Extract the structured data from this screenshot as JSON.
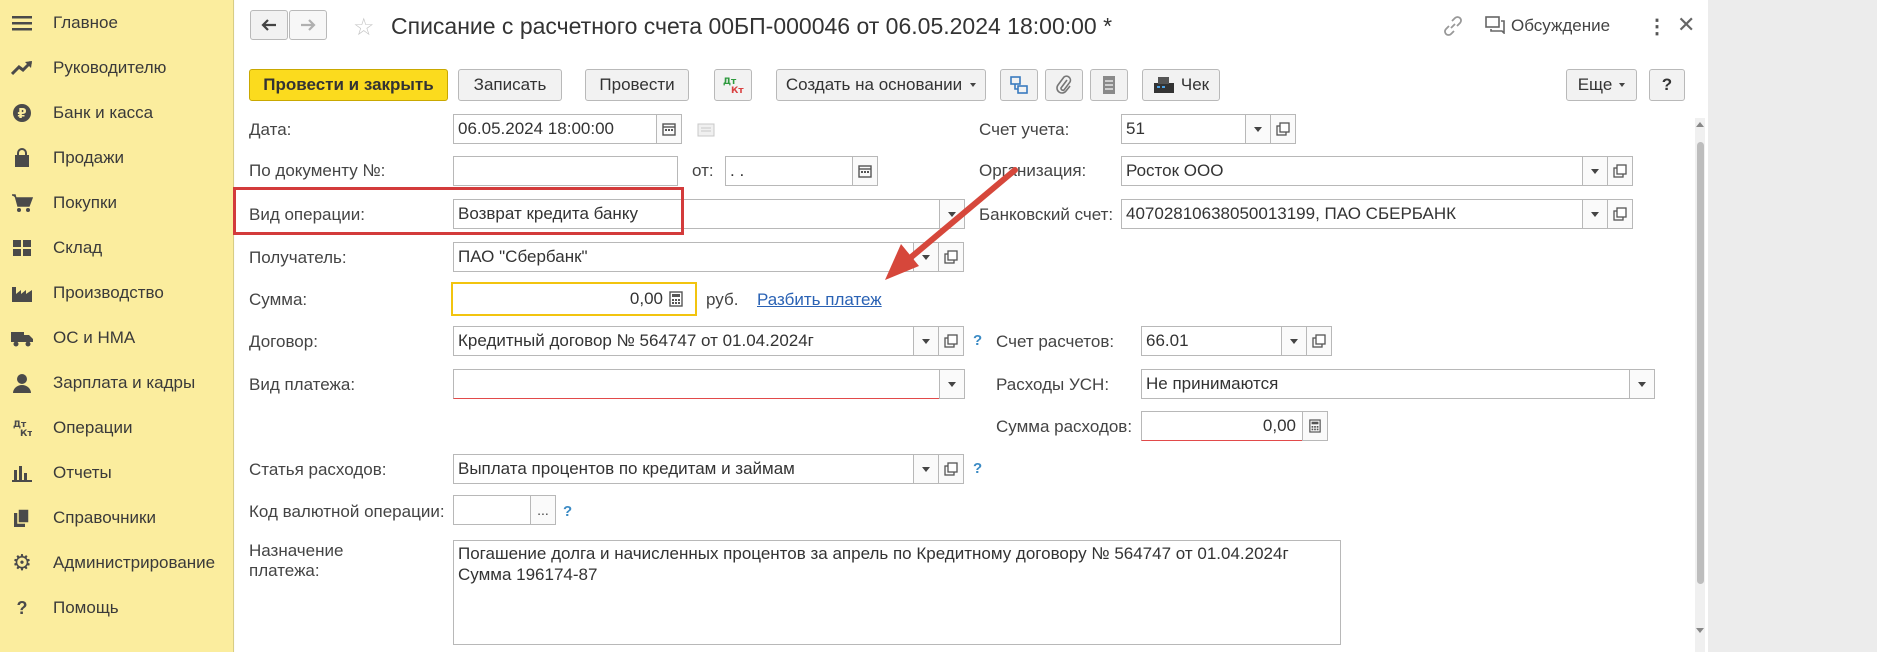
{
  "sidebar": {
    "items": [
      {
        "label": "Главное",
        "icon": "menu-icon"
      },
      {
        "label": "Руководителю",
        "icon": "trend-icon"
      },
      {
        "label": "Банк и касса",
        "icon": "ruble-icon"
      },
      {
        "label": "Продажи",
        "icon": "bag-icon"
      },
      {
        "label": "Покупки",
        "icon": "cart-icon"
      },
      {
        "label": "Склад",
        "icon": "warehouse-icon"
      },
      {
        "label": "Производство",
        "icon": "factory-icon"
      },
      {
        "label": "ОС и НМА",
        "icon": "truck-icon"
      },
      {
        "label": "Зарплата и кадры",
        "icon": "person-icon"
      },
      {
        "label": "Операции",
        "icon": "dt-kt-icon"
      },
      {
        "label": "Отчеты",
        "icon": "bar-chart-icon"
      },
      {
        "label": "Справочники",
        "icon": "books-icon"
      },
      {
        "label": "Администрирование",
        "icon": "gear-icon"
      },
      {
        "label": "Помощь",
        "icon": "question-icon"
      }
    ]
  },
  "header": {
    "title": "Списание с расчетного счета 00БП-000046 от 06.05.2024 18:00:00 *",
    "discussion_label": "Обсуждение"
  },
  "toolbar": {
    "post_close": "Провести и закрыть",
    "save": "Записать",
    "post": "Провести",
    "dt_kt": "Дт Кт",
    "create_based": "Создать на основании",
    "check": "Чек",
    "more": "Еще",
    "help": "?"
  },
  "form": {
    "date_label": "Дата:",
    "date_value": "06.05.2024 18:00:00",
    "doc_num_label": "По документу №:",
    "doc_num_value": "",
    "from_label": "от:",
    "from_value": " .  .",
    "op_type_label": "Вид операции:",
    "op_type_value": "Возврат кредита банку",
    "recipient_label": "Получатель:",
    "recipient_value": "ПАО \"Сбербанк\"",
    "sum_label": "Сумма:",
    "sum_value": "0,00",
    "currency": "руб.",
    "split_link": "Разбить платеж",
    "contract_label": "Договор:",
    "contract_value": "Кредитный договор № 564747 от 01.04.2024г",
    "payment_type_label": "Вид платежа:",
    "payment_type_value": "",
    "expense_item_label": "Статья расходов:",
    "expense_item_value": "Выплата процентов по кредитам и займам",
    "currency_op_label": "Код валютной операции:",
    "currency_op_value": "",
    "purpose_label_1": "Назначение",
    "purpose_label_2": "платежа:",
    "purpose_line_1": "Погашение долга и начисленных процентов за апрель по Кредитному договору № 564747 от 01.04.2024г",
    "purpose_line_2": "Сумма 196174-87",
    "account_label": "Счет учета:",
    "account_value": "51",
    "org_label": "Организация:",
    "org_value": "Росток ООО",
    "bank_account_label": "Банковский счет:",
    "bank_account_value": "40702810638050013199, ПАО СБЕРБАНК",
    "settle_account_label": "Счет расчетов:",
    "settle_account_value": "66.01",
    "usn_label": "Расходы УСН:",
    "usn_value": "Не принимаются",
    "expense_sum_label": "Сумма расходов:",
    "expense_sum_value": "0,00"
  },
  "colors": {
    "sidebar_bg": "#fbed9e",
    "primary_button": "#fbdb1e",
    "highlight_box": "#d33b3b",
    "focus_border": "#f2c40f",
    "link": "#2a62b4"
  }
}
